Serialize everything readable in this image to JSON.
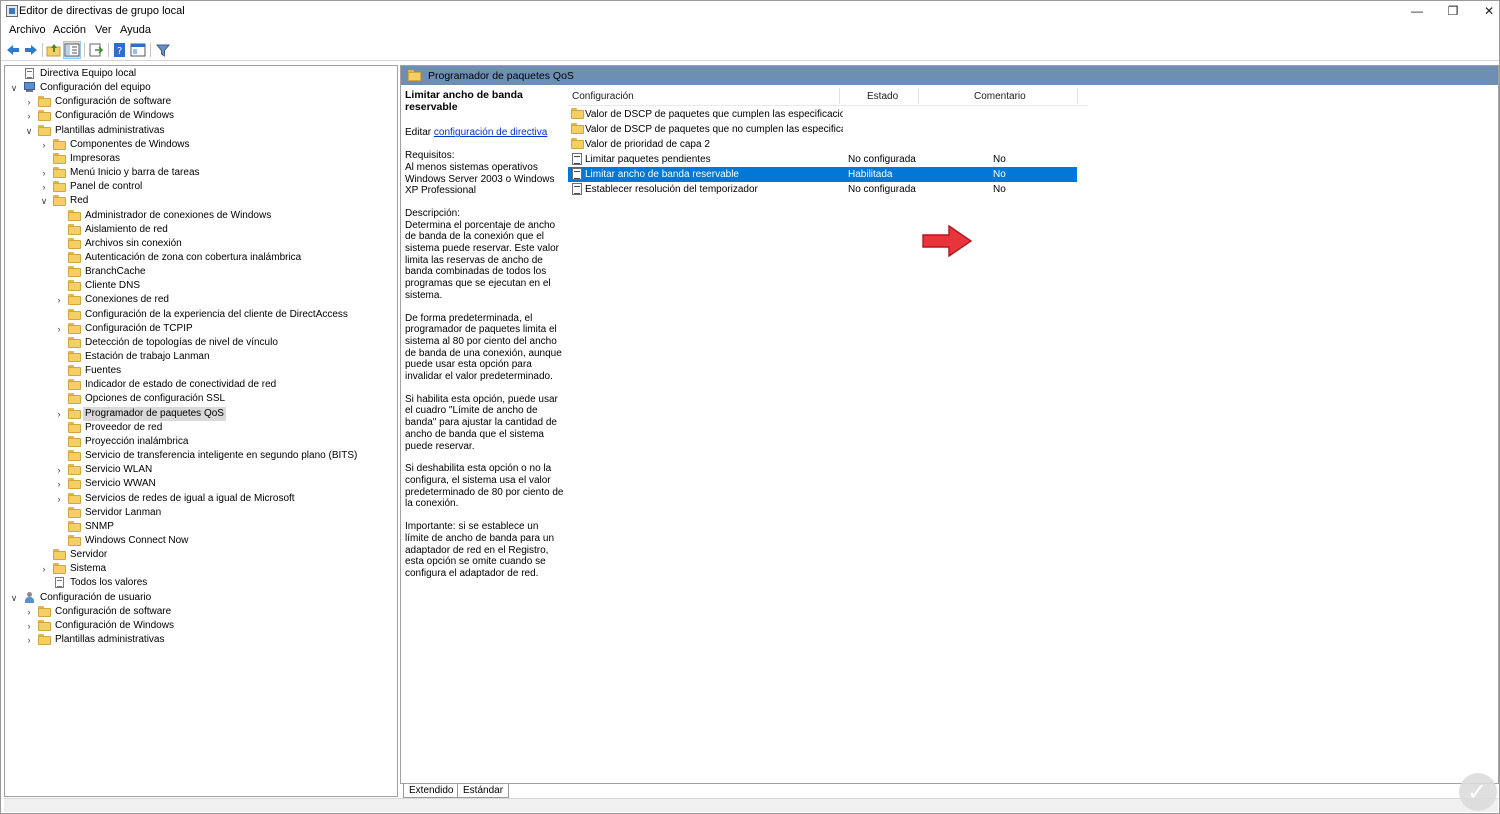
{
  "window": {
    "title": "Editor de directivas de grupo local",
    "minimize": "—",
    "maximize": "❐",
    "close": "✕"
  },
  "menu": {
    "items": [
      "Archivo",
      "Acción",
      "Ver",
      "Ayuda"
    ]
  },
  "toolbar": {
    "icons": [
      "back-arrow-icon",
      "forward-arrow-icon",
      "folder-up-icon",
      "show-hide-tree-icon",
      "export-list-icon",
      "help-icon",
      "properties-icon",
      "filter-icon"
    ]
  },
  "tree": {
    "items": [
      {
        "label": "Directiva Equipo local",
        "icon": "document",
        "level": 0,
        "expander": ""
      },
      {
        "label": "Configuración del equipo",
        "icon": "computer",
        "level": 0,
        "expander": "∨"
      },
      {
        "label": "Configuración de software",
        "icon": "folder",
        "level": 1,
        "expander": "›"
      },
      {
        "label": "Configuración de Windows",
        "icon": "folder",
        "level": 1,
        "expander": "›"
      },
      {
        "label": "Plantillas administrativas",
        "icon": "folder",
        "level": 1,
        "expander": "∨"
      },
      {
        "label": "Componentes de Windows",
        "icon": "folder",
        "level": 2,
        "expander": "›"
      },
      {
        "label": "Impresoras",
        "icon": "folder",
        "level": 2,
        "expander": ""
      },
      {
        "label": "Menú Inicio y barra de tareas",
        "icon": "folder",
        "level": 2,
        "expander": "›"
      },
      {
        "label": "Panel de control",
        "icon": "folder",
        "level": 2,
        "expander": "›"
      },
      {
        "label": "Red",
        "icon": "folder",
        "level": 2,
        "expander": "∨"
      },
      {
        "label": "Administrador de conexiones de Windows",
        "icon": "folder",
        "level": 3,
        "expander": ""
      },
      {
        "label": "Aislamiento de red",
        "icon": "folder",
        "level": 3,
        "expander": ""
      },
      {
        "label": "Archivos sin conexión",
        "icon": "folder",
        "level": 3,
        "expander": ""
      },
      {
        "label": "Autenticación de zona con cobertura inalámbrica",
        "icon": "folder",
        "level": 3,
        "expander": ""
      },
      {
        "label": "BranchCache",
        "icon": "folder",
        "level": 3,
        "expander": ""
      },
      {
        "label": "Cliente DNS",
        "icon": "folder",
        "level": 3,
        "expander": ""
      },
      {
        "label": "Conexiones de red",
        "icon": "folder",
        "level": 3,
        "expander": "›"
      },
      {
        "label": "Configuración de la experiencia del cliente de DirectAccess",
        "icon": "folder",
        "level": 3,
        "expander": ""
      },
      {
        "label": "Configuración de TCPIP",
        "icon": "folder",
        "level": 3,
        "expander": "›"
      },
      {
        "label": "Detección de topologías de nivel de vínculo",
        "icon": "folder",
        "level": 3,
        "expander": ""
      },
      {
        "label": "Estación de trabajo Lanman",
        "icon": "folder",
        "level": 3,
        "expander": ""
      },
      {
        "label": "Fuentes",
        "icon": "folder",
        "level": 3,
        "expander": ""
      },
      {
        "label": "Indicador de estado de conectividad de red",
        "icon": "folder",
        "level": 3,
        "expander": ""
      },
      {
        "label": "Opciones de configuración SSL",
        "icon": "folder",
        "level": 3,
        "expander": ""
      },
      {
        "label": "Programador de paquetes QoS",
        "icon": "folder",
        "level": 3,
        "expander": "›",
        "selected": true
      },
      {
        "label": "Proveedor de red",
        "icon": "folder",
        "level": 3,
        "expander": ""
      },
      {
        "label": "Proyección inalámbrica",
        "icon": "folder",
        "level": 3,
        "expander": ""
      },
      {
        "label": "Servicio de transferencia inteligente en segundo plano (BITS)",
        "icon": "folder",
        "level": 3,
        "expander": ""
      },
      {
        "label": "Servicio WLAN",
        "icon": "folder",
        "level": 3,
        "expander": "›"
      },
      {
        "label": "Servicio WWAN",
        "icon": "folder",
        "level": 3,
        "expander": "›"
      },
      {
        "label": "Servicios de redes de igual a igual de Microsoft",
        "icon": "folder",
        "level": 3,
        "expander": "›"
      },
      {
        "label": "Servidor Lanman",
        "icon": "folder",
        "level": 3,
        "expander": ""
      },
      {
        "label": "SNMP",
        "icon": "folder",
        "level": 3,
        "expander": ""
      },
      {
        "label": "Windows Connect Now",
        "icon": "folder",
        "level": 3,
        "expander": ""
      },
      {
        "label": "Servidor",
        "icon": "folder",
        "level": 2,
        "expander": ""
      },
      {
        "label": "Sistema",
        "icon": "folder",
        "level": 2,
        "expander": "›"
      },
      {
        "label": "Todos los valores",
        "icon": "doc-folder",
        "level": 2,
        "expander": ""
      },
      {
        "label": "Configuración de usuario",
        "icon": "user",
        "level": 0,
        "expander": "∨"
      },
      {
        "label": "Configuración de software",
        "icon": "folder",
        "level": 1,
        "expander": "›"
      },
      {
        "label": "Configuración de Windows",
        "icon": "folder",
        "level": 1,
        "expander": "›"
      },
      {
        "label": "Plantillas administrativas",
        "icon": "folder",
        "level": 1,
        "expander": "›"
      }
    ]
  },
  "header": {
    "path_title": "Programador de paquetes QoS"
  },
  "description": {
    "title": "Limitar ancho de banda reservable",
    "edit_prefix": "Editar ",
    "edit_link": "configuración de directiva",
    "requirements_label": "Requisitos:",
    "requirements_text": "Al menos sistemas operativos Windows Server 2003 o Windows XP Professional",
    "description_label": "Descripción:",
    "paragraphs": [
      "Determina el porcentaje de ancho de banda de la conexión que el sistema puede reservar. Este valor limita las reservas de ancho de banda combinadas de todos los programas que se ejecutan en el sistema.",
      "De forma predeterminada, el programador de paquetes limita el sistema al 80 por ciento del ancho de banda de una conexión, aunque puede usar esta opción para invalidar el valor predeterminado.",
      "Si habilita esta opción, puede usar el cuadro \"Límite de ancho de banda\" para ajustar la cantidad de ancho de banda que el sistema puede reservar.",
      "Si deshabilita esta opción o no la configura, el sistema usa el valor predeterminado de 80 por ciento de la conexión.",
      "Importante: si se establece un límite de ancho de banda para un adaptador de red en el Registro, esta opción se omite cuando se configura el adaptador de red."
    ]
  },
  "grid": {
    "columns": {
      "name": "Configuración",
      "state": "Estado",
      "comment": "Comentario"
    },
    "rows": [
      {
        "name": "Valor de DSCP de paquetes que cumplen las especificaciones",
        "state": "",
        "comment": "",
        "icon": "folder"
      },
      {
        "name": "Valor de DSCP de paquetes que no cumplen las especificaci...",
        "state": "",
        "comment": "",
        "icon": "folder"
      },
      {
        "name": "Valor de prioridad de capa 2",
        "state": "",
        "comment": "",
        "icon": "folder"
      },
      {
        "name": "Limitar paquetes pendientes",
        "state": "No configurada",
        "comment": "No",
        "icon": "policy"
      },
      {
        "name": "Limitar ancho de banda reservable",
        "state": "Habilitada",
        "comment": "No",
        "icon": "policy",
        "selected": true
      },
      {
        "name": "Establecer resolución del temporizador",
        "state": "No configurada",
        "comment": "No",
        "icon": "policy"
      }
    ]
  },
  "tabs": [
    "Extendido",
    "Estándar"
  ],
  "colors": {
    "selection": "#0078d7",
    "header_band": "#6e8fb4",
    "arrow": "#e8353b",
    "link": "#0033cc"
  },
  "watermark": {
    "glyph": "✓"
  }
}
